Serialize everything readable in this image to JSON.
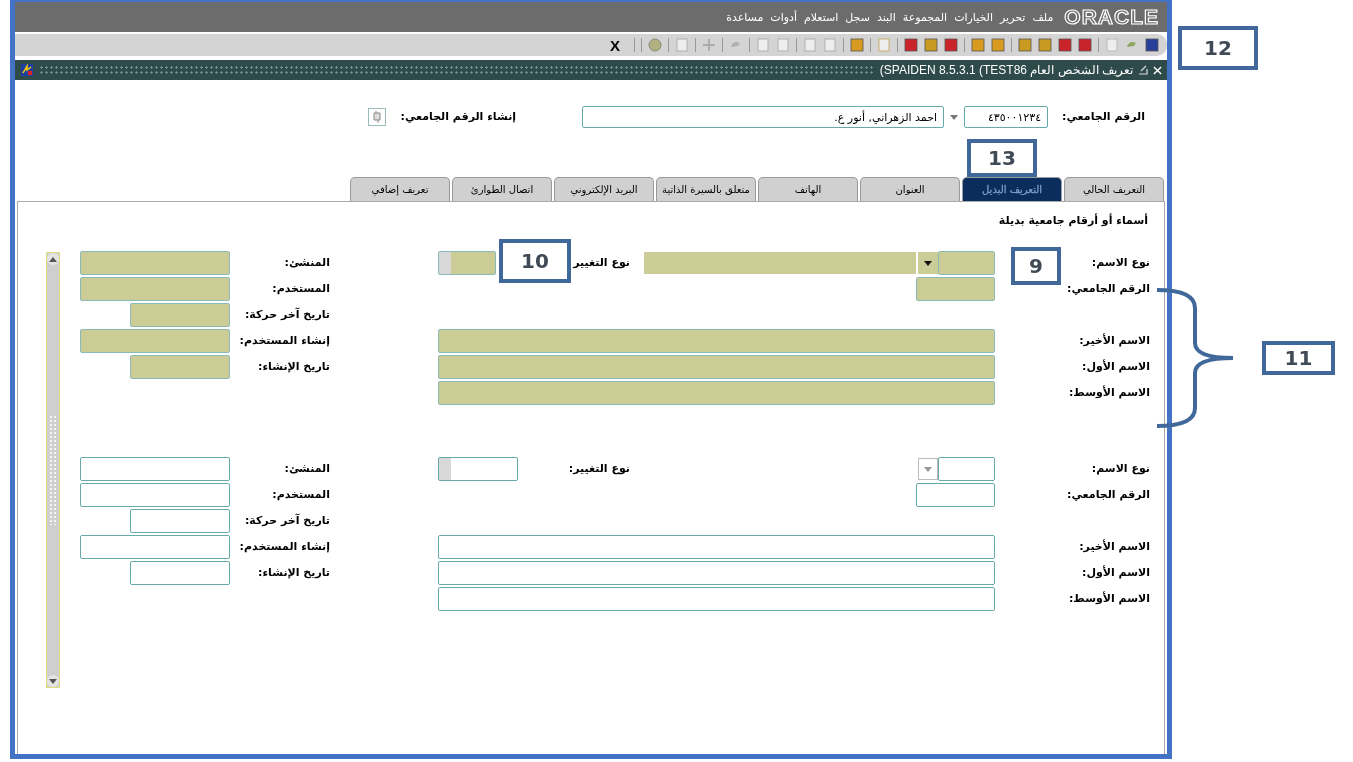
{
  "menu_bar": {
    "logo": "ORACLE",
    "items": [
      "ملف",
      "تحرير",
      "الخيارات",
      "المجموعة",
      "البند",
      "سجل",
      "استعلام",
      "أدوات",
      "مساعدة"
    ]
  },
  "toolbar": {
    "exit_label": "X"
  },
  "form_window": {
    "title": "(SPAIDEN 8.5.3.1  (TEST86  تعريف الشخص العام"
  },
  "key_block": {
    "id_label": "الرقم الجامعي:",
    "id_value": "٤٣٥٠٠١٢٣٤",
    "name_value": "احمد الزهراني, أنور ع.",
    "generate_label": "إنشاء الرقم الجامعي:"
  },
  "tabs": [
    {
      "label": "التعريف الحالي",
      "selected": false
    },
    {
      "label": "التعريف البديل",
      "selected": true
    },
    {
      "label": "العنوان",
      "selected": false
    },
    {
      "label": "الهاتف",
      "selected": false
    },
    {
      "label": "متعلق بالسيرة الذاتية",
      "selected": false
    },
    {
      "label": "البريد الإلكتروني",
      "selected": false
    },
    {
      "label": "اتصال الطوارئ",
      "selected": false
    },
    {
      "label": "تعريف إضافي",
      "selected": false
    }
  ],
  "section_title": "أسماء أو أرقام جامعية بديلة",
  "records": [
    {
      "current": true,
      "labels": {
        "name_type": "نوع الاسم:",
        "id": "الرقم الجامعي:",
        "last_name": "الاسم الأخير:",
        "first_name": "الاسم الأول:",
        "middle_name": "الاسم الأوسط:",
        "change_type": "نوع التغيير",
        "origin": "المنشئ:",
        "user": "المستخدم:",
        "activity_date": "تاريخ آخر حركة:",
        "create_user": "إنشاء المستخدم:",
        "create_date": "تاريخ الإنشاء:"
      }
    },
    {
      "current": false,
      "labels": {
        "name_type": "نوع الاسم:",
        "id": "الرقم الجامعي:",
        "last_name": "الاسم الأخير:",
        "first_name": "الاسم الأول:",
        "middle_name": "الاسم الأوسط:",
        "change_type": "نوع التغيير:",
        "origin": "المنشئ:",
        "user": "المستخدم:",
        "activity_date": "تاريخ آخر حركة:",
        "create_user": "إنشاء المستخدم:",
        "create_date": "تاريخ الإنشاء:"
      }
    }
  ],
  "callouts": [
    {
      "label": "12"
    },
    {
      "label": "13"
    },
    {
      "label": "9"
    },
    {
      "label": "10"
    },
    {
      "label": "11"
    }
  ]
}
